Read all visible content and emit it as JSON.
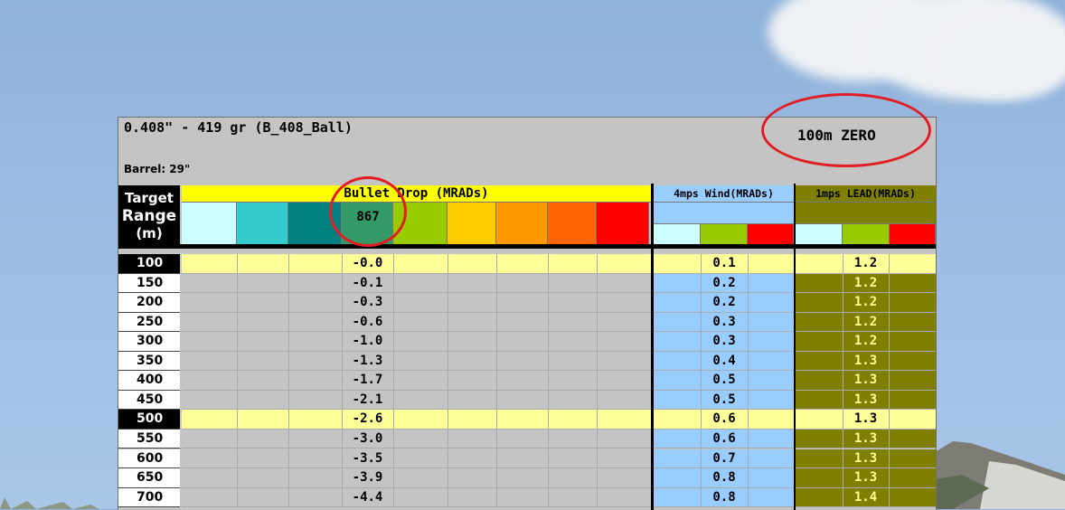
{
  "ammo_title": "0.408\" - 419 gr (B_408_Ball)",
  "barrel_label": "Barrel: 29\"",
  "zero_label": "100m ZERO",
  "range_header": {
    "line1": "Target",
    "line2": "Range",
    "line3": "(m)"
  },
  "drop_header": "Bullet Drop (MRADs)",
  "wind_header": "4mps Wind(MRADs)",
  "lead_header": "1mps LEAD(MRADs)",
  "selected_swatch_value": "867",
  "colors": {
    "drop_header_bg": "#ffff00",
    "wind_bg": "#99ccff",
    "lead_bg": "#808000",
    "highlight_row_bg": "#ffff99",
    "annotation_red": "#e11d23",
    "drop_swatches": [
      "#ccffff",
      "#33cccc",
      "#008080",
      "#339966",
      "#99cc00",
      "#ffcc00",
      "#ff9900",
      "#ff6600",
      "#ff0000"
    ],
    "small_swatches": [
      "#ccffff",
      "#99cc00",
      "#ff0000"
    ]
  },
  "rows": [
    {
      "range": "100",
      "drop": "-0.0",
      "wind": "0.1",
      "lead": "1.2",
      "highlight": true
    },
    {
      "range": "150",
      "drop": "-0.1",
      "wind": "0.2",
      "lead": "1.2",
      "highlight": false
    },
    {
      "range": "200",
      "drop": "-0.3",
      "wind": "0.2",
      "lead": "1.2",
      "highlight": false
    },
    {
      "range": "250",
      "drop": "-0.6",
      "wind": "0.3",
      "lead": "1.2",
      "highlight": false
    },
    {
      "range": "300",
      "drop": "-1.0",
      "wind": "0.3",
      "lead": "1.2",
      "highlight": false
    },
    {
      "range": "350",
      "drop": "-1.3",
      "wind": "0.4",
      "lead": "1.3",
      "highlight": false
    },
    {
      "range": "400",
      "drop": "-1.7",
      "wind": "0.5",
      "lead": "1.3",
      "highlight": false
    },
    {
      "range": "450",
      "drop": "-2.1",
      "wind": "0.5",
      "lead": "1.3",
      "highlight": false
    },
    {
      "range": "500",
      "drop": "-2.6",
      "wind": "0.6",
      "lead": "1.3",
      "highlight": true
    },
    {
      "range": "550",
      "drop": "-3.0",
      "wind": "0.6",
      "lead": "1.3",
      "highlight": false
    },
    {
      "range": "600",
      "drop": "-3.5",
      "wind": "0.7",
      "lead": "1.3",
      "highlight": false
    },
    {
      "range": "650",
      "drop": "-3.9",
      "wind": "0.8",
      "lead": "1.3",
      "highlight": false
    },
    {
      "range": "700",
      "drop": "-4.4",
      "wind": "0.8",
      "lead": "1.4",
      "highlight": false
    }
  ]
}
